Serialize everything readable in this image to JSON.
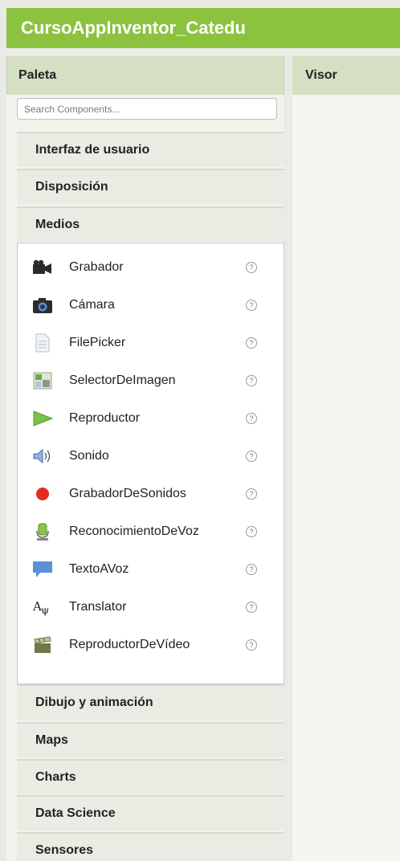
{
  "app": {
    "title": "CursoAppInventor_Catedu"
  },
  "palette": {
    "header": "Paleta",
    "search": {
      "placeholder": "Search Components..."
    },
    "categories_top": [
      "Interfaz de usuario",
      "Disposición",
      "Medios"
    ],
    "media_items": [
      {
        "label": "Grabador",
        "icon": "video-camera-icon"
      },
      {
        "label": "Cámara",
        "icon": "camera-icon"
      },
      {
        "label": "FilePicker",
        "icon": "file-icon"
      },
      {
        "label": "SelectorDeImagen",
        "icon": "image-icon"
      },
      {
        "label": "Reproductor",
        "icon": "play-icon"
      },
      {
        "label": "Sonido",
        "icon": "speaker-icon"
      },
      {
        "label": "GrabadorDeSonidos",
        "icon": "record-dot-icon"
      },
      {
        "label": "ReconocimientoDeVoz",
        "icon": "microphone-icon"
      },
      {
        "label": "TextoAVoz",
        "icon": "speech-bubble-icon"
      },
      {
        "label": "Translator",
        "icon": "translate-icon"
      },
      {
        "label": "ReproductorDeVídeo",
        "icon": "clapperboard-icon"
      }
    ],
    "help_symbol": "?",
    "categories_bottom": [
      "Dibujo y animación",
      "Maps",
      "Charts",
      "Data Science",
      "Sensores"
    ]
  },
  "visor": {
    "header": "Visor"
  },
  "colors": {
    "accent": "#8bc33f",
    "header_bg": "#d5dfc2",
    "record_red": "#e52b20"
  }
}
